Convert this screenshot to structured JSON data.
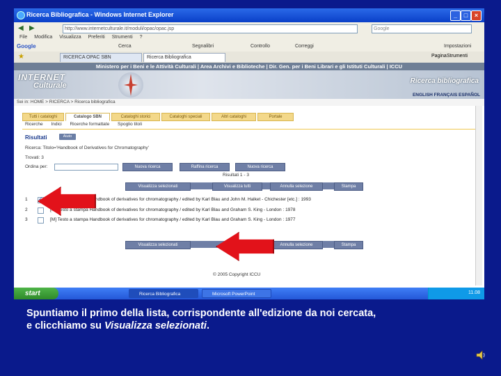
{
  "browser": {
    "title": "Ricerca Bibliografica - Windows Internet Explorer",
    "address": "http://www.internetculturale.it/moduli/opac/opac.jsp",
    "search_placeholder": "Google",
    "menu": [
      "File",
      "Modifica",
      "Visualizza",
      "Preferiti",
      "Strumenti",
      "?"
    ],
    "google_items": [
      "Google",
      "Cerca",
      "Segnalibri",
      "Controllo",
      "Correggi"
    ],
    "google_right": "Impostazioni",
    "tabs": [
      "RICERCA OPAC SBN",
      "Ricerca Bibliografica"
    ],
    "tab_right": [
      "Pagina",
      "Strumenti"
    ]
  },
  "site": {
    "ministry_bar": "Ministero per i Beni e le Attività Culturali | Area Archivi e Biblioteche | Dir. Gen. per i Beni Librari e gli Istituti Culturali | ICCU",
    "logo_line1": "INTERNET",
    "logo_line2": "Culturale",
    "section_title": "Ricerca bibliografica",
    "languages": "ENGLISH  FRANÇAIS  ESPAÑOL",
    "breadcrumb": "Sei in:  HOME > RICERCA > Ricerca bibliografica"
  },
  "content_tabs": [
    "Tutti i cataloghi",
    "Catalogo SBN",
    "Cataloghi storici",
    "Cataloghi speciali",
    "Altri cataloghi",
    "Portale"
  ],
  "sub_tabs": [
    "Ricerche",
    "Indici",
    "Ricerche formattate",
    "Spoglio titoli"
  ],
  "results": {
    "heading": "Risultati",
    "help_badge": "Aiuto",
    "query": "Ricerca: Titolo='Handbook of Derivatives for Chromatography'",
    "found": "Trovati: 3",
    "order_label": "Ordina per:",
    "order_buttons": [
      "Nuova ricerca",
      "Raffina ricerca",
      "Nuova ricerca"
    ],
    "range": "Risultati 1 - 3",
    "action_buttons": [
      "Visualizza selezionati",
      "Visualizza tutti",
      "Annulla selezione",
      "Stampa"
    ],
    "rows": [
      {
        "num": "1",
        "checked": true,
        "text": "[M] Testo a stampa   Handbook of derivatives for chromatography / edited by Karl Blau and John M. Halket  - Chichester [etc.] : 1993"
      },
      {
        "num": "2",
        "checked": false,
        "text": "[M] Testo a stampa   Handbook of derivatives for chromatography / edited by Karl Blau and Graham S. King - London : 1978"
      },
      {
        "num": "3",
        "checked": false,
        "text": "[M] Testo a stampa   Handbook of derivatives for chromatography / edited by Karl Blau and Graham S. King - London : 1977"
      }
    ],
    "bottom_buttons": [
      "Visualizza selezionati",
      "Annulla selezione",
      "Stampa"
    ],
    "copyright": "© 2005 Copyright ICCU"
  },
  "taskbar": {
    "start": "start",
    "items": [
      "Ricerca Bibliografica",
      "Microsoft PowerPoint"
    ],
    "clock": "11.08"
  },
  "caption": {
    "line1": "Spuntiamo il primo della lista, corrispondente all'edizione da noi cercata,",
    "line2_prefix": "e clicchiamo su ",
    "line2_italic": "Visualizza selezionati",
    "line2_suffix": "."
  },
  "colors": {
    "background": "#0a1a8c",
    "arrow": "#e2121a",
    "button": "#6f7fa6",
    "tab_gold": "#f3d88a"
  }
}
